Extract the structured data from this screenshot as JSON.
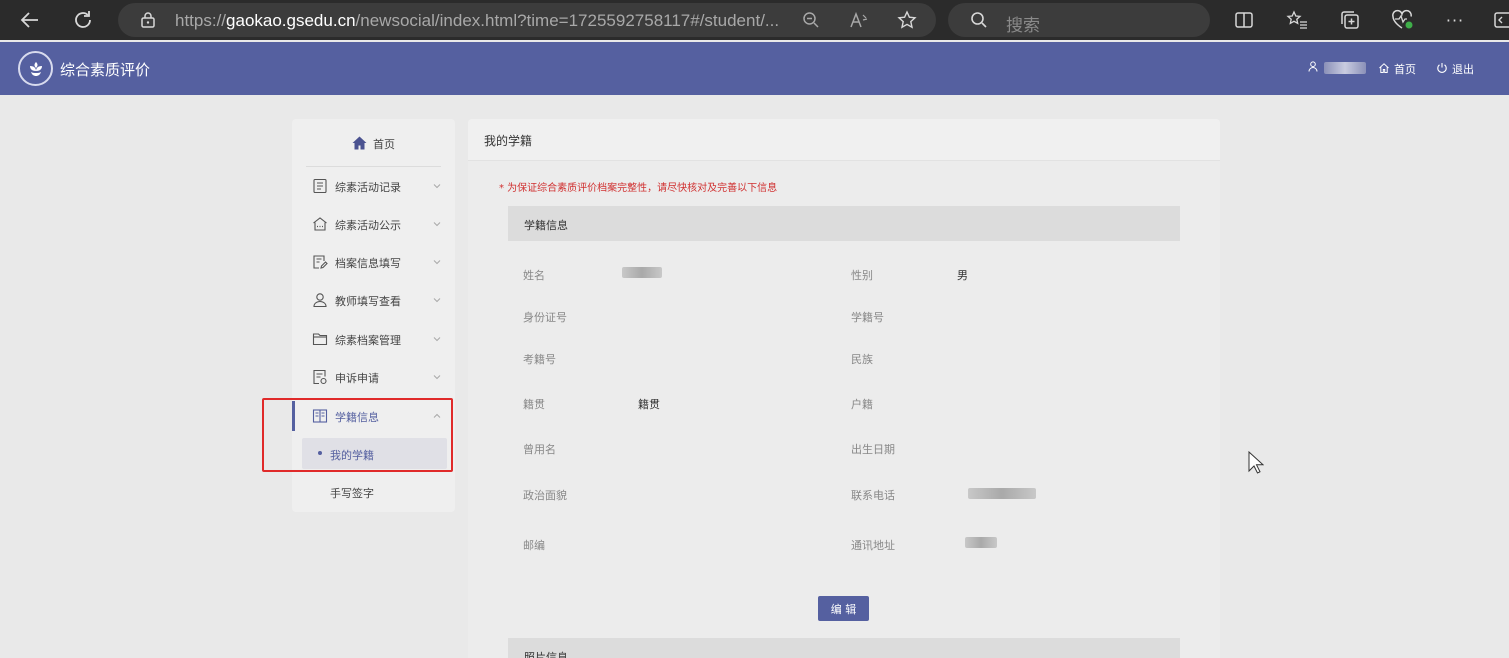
{
  "browser": {
    "url_prefix": "https://",
    "url_domain": "gaokao.gsedu.cn",
    "url_path": "/newsocial/index.html?time=1725592758117#/student/...",
    "search_placeholder": "搜索",
    "more_label": "···"
  },
  "header": {
    "title": "综合素质评价",
    "home_label": "首页",
    "logout_label": "退出",
    "accent_color": "#5560a0"
  },
  "sidebar": {
    "home_label": "首页",
    "items": [
      {
        "label": "综素活动记录",
        "icon": "document-list-icon"
      },
      {
        "label": "综素活动公示",
        "icon": "building-icon"
      },
      {
        "label": "档案信息填写",
        "icon": "edit-doc-icon"
      },
      {
        "label": "教师填写查看",
        "icon": "user-icon"
      },
      {
        "label": "综素档案管理",
        "icon": "folder-icon"
      },
      {
        "label": "申诉申请",
        "icon": "appeal-doc-icon"
      },
      {
        "label": "学籍信息",
        "icon": "book-icon"
      }
    ],
    "sub_items": [
      "我的学籍",
      "手写签字"
    ]
  },
  "main": {
    "title": "我的学籍",
    "notice": "* 为保证综合素质评价档案完整性，请尽快核对及完善以下信息",
    "section_title": "学籍信息",
    "fields": {
      "name_label": "姓名",
      "gender_label": "性别",
      "gender_value": "男",
      "id_label": "身份证号",
      "student_no_label": "学籍号",
      "exam_no_label": "考籍号",
      "ethnicity_label": "民族",
      "native_label": "籍贯",
      "native_value": "籍贯",
      "household_label": "户籍",
      "alias_label": "曾用名",
      "birth_label": "出生日期",
      "political_label": "政治面貌",
      "phone_label": "联系电话",
      "postal_label": "邮编",
      "address_label": "通讯地址"
    },
    "edit_label": "编 辑",
    "photo_section_title": "照片信息"
  }
}
